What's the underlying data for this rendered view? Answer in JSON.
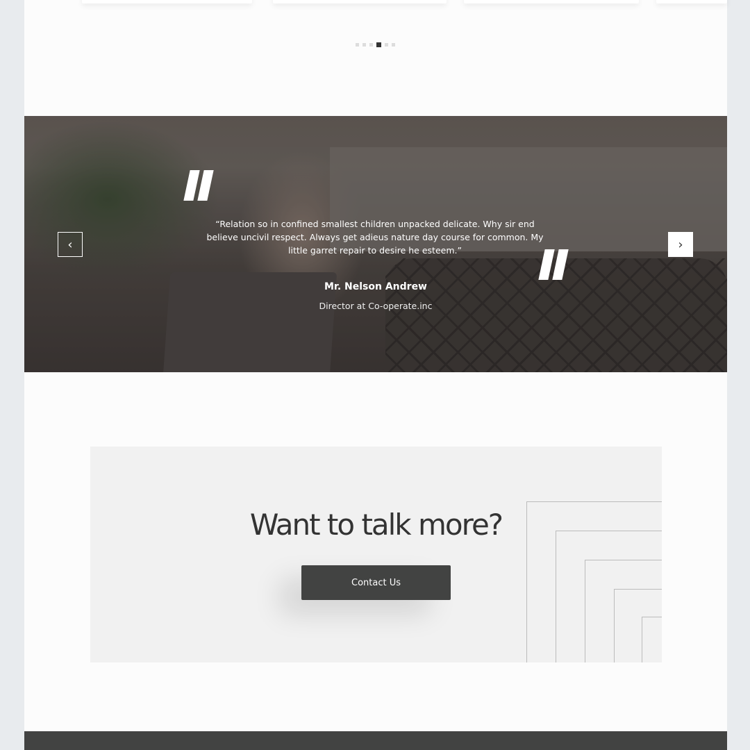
{
  "carousel": {
    "dot_count": 6,
    "active_index": 3
  },
  "testimonial": {
    "quote": "“Relation so in confined smallest children unpacked delicate. Why sir end believe uncivil respect. Always get adieus nature day course for common. My little garret repair to desire he esteem.”",
    "name": "Mr. Nelson Andrew",
    "role": "Director at Co-operate.inc",
    "prev_icon": "chevron-left-icon",
    "next_icon": "chevron-right-icon"
  },
  "cta": {
    "heading": "Want to talk more?",
    "button_label": "Contact Us"
  },
  "colors": {
    "accent": "#424342",
    "cta_bg": "#f1f1f1",
    "page_bg": "#fcfcfc"
  }
}
